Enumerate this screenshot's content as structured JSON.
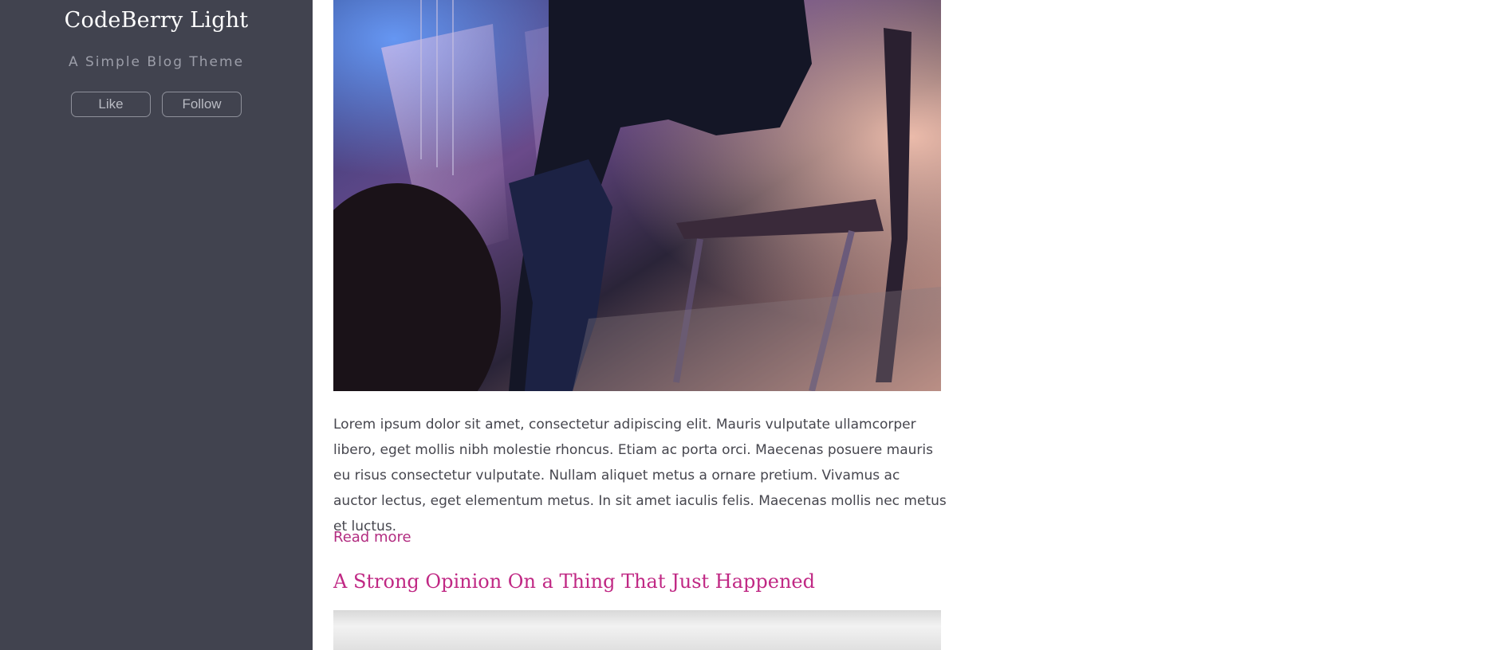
{
  "sidebar": {
    "title": "CodeBerry Light",
    "subtitle": "A Simple Blog Theme",
    "like_label": "Like",
    "follow_label": "Follow"
  },
  "post": {
    "body": "Lorem ipsum dolor sit amet, consectetur adipiscing elit. Mauris vulputate ullamcorper libero, eget mollis nibh molestie rhoncus. Etiam ac porta orci. Maecenas posuere mauris eu risus consectetur vulputate. Nullam aliquet metus a ornare pretium. Vivamus ac auctor lectus, eget elementum metus. In sit amet iaculis felis. Maecenas mollis nec metus et luctus.",
    "read_more": "Read more"
  },
  "next_post": {
    "title": "A Strong Opinion On a Thing That Just Happened"
  },
  "colors": {
    "sidebar_bg": "#41434f",
    "link": "#b22c80",
    "post_title": "#c02884"
  }
}
